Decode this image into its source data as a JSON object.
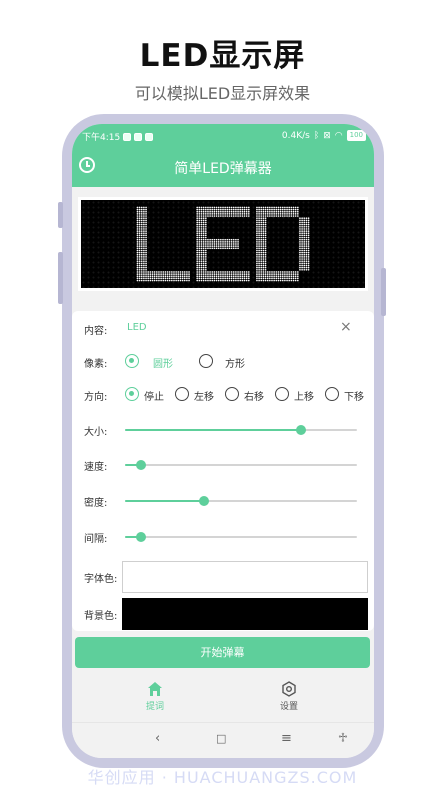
{
  "promo": {
    "headline": "LED显示屏",
    "subline": "可以模拟LED显示屏效果",
    "watermark": "华创应用 · HUACHUANGZS.COM"
  },
  "status_bar": {
    "time": "下午4:15",
    "speed": "0.4K/s",
    "battery": "100"
  },
  "app": {
    "title": "简单LED弹幕器",
    "led_text": "LED"
  },
  "settings": {
    "content_label": "内容:",
    "content_value": "LED",
    "clear_icon": "×",
    "pixel_label": "像素:",
    "pixel_options": [
      "圆形",
      "方形"
    ],
    "pixel_selected": "圆形",
    "direction_label": "方向:",
    "direction_options": [
      "停止",
      "左移",
      "右移",
      "上移",
      "下移"
    ],
    "direction_selected": "停止",
    "size_label": "大小:",
    "size_value": 0.76,
    "speed_label": "速度:",
    "speed_value": 0.07,
    "density_label": "密度:",
    "density_value": 0.34,
    "spacing_label": "间隔:",
    "spacing_value": 0.07,
    "font_color_label": "字体色:",
    "font_color": "#ffffff",
    "bg_color_label": "背景色:",
    "bg_color": "#000000",
    "start_button": "开始弹幕"
  },
  "bottom_nav": {
    "items": [
      {
        "label": "提词",
        "icon": "home-icon",
        "active": true
      },
      {
        "label": "设置",
        "icon": "gear-icon",
        "active": false
      }
    ]
  },
  "colors": {
    "accent": "#5ecf9b",
    "led_dot": "#ffffff"
  }
}
